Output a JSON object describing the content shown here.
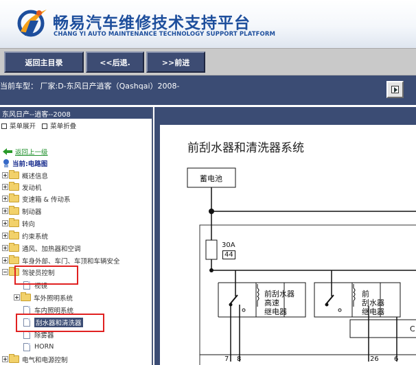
{
  "header": {
    "title_cn": "畅易汽车维修技术支持平台",
    "title_en": "CHANG YI AUTO MAINTENANCE TECHNOLOGY SUPPORT PLATFORM",
    "logo_icon": "cy-logo-icon"
  },
  "nav": {
    "home_label": "返回主目录",
    "back_label": "<<后退.",
    "forward_label": ">>前进"
  },
  "model_bar": {
    "text": "当前车型：  厂家:D-东风日产逍客（Qashqai）2008-"
  },
  "tree": {
    "title": "东风日产--逍客--2008",
    "expand_label": "菜单展开",
    "collapse_label": "菜单折叠",
    "back_link": "返回上一级",
    "current_label": "当前:电路图",
    "items": [
      {
        "label": "概述信息"
      },
      {
        "label": "发动机"
      },
      {
        "label": "变速箱 & 传动系"
      },
      {
        "label": "制动器"
      },
      {
        "label": "转向"
      },
      {
        "label": "约束系统"
      },
      {
        "label": "通风、加热器和空调"
      },
      {
        "label": "车身外部、车门、车顶和车辆安全"
      },
      {
        "label": "驾驶员控制"
      },
      {
        "label": "视镜"
      },
      {
        "label": "车外照明系统"
      },
      {
        "label": "车内照明系统"
      },
      {
        "label": "刮水器和清洗器"
      },
      {
        "label": "除雾器"
      },
      {
        "label": "HORN"
      },
      {
        "label": "电气和电源控制"
      }
    ]
  },
  "diagram": {
    "title": "前刮水器和清洗器系统",
    "battery_label": "蓄电池",
    "fuse_rating": "30A",
    "fuse_number": "44",
    "relay1_line1": "前刮水器",
    "relay1_line2": "高速",
    "relay1_line3": "继电器",
    "relay2_line1": "前",
    "relay2_line2": "刮水器",
    "relay2_line3": "继电器",
    "partial_label": "C",
    "pin_7": "7",
    "pin_8": "8",
    "pin_26": "26",
    "pin_6": "6"
  },
  "colors": {
    "header_blue": "#1d4e9c",
    "nav_button": "#3d4c73",
    "panel_blue": "#3b4c74",
    "highlight_red": "#e02020",
    "link_green": "#1d8f2a",
    "current_blue": "#1b2f8f"
  }
}
